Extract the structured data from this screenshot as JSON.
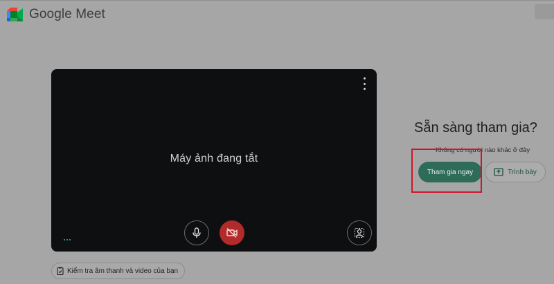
{
  "app": {
    "title": "Google Meet"
  },
  "preview": {
    "camera_off_text": "Máy ảnh đang tắt"
  },
  "icons": {
    "logo": "google-meet-logo",
    "more": "more-vert-icon",
    "mic": "mic-icon",
    "camera_off": "videocam-off-icon",
    "effects": "visual-effects-icon",
    "check": "clipboard-check-icon",
    "present": "present-screen-icon"
  },
  "check_av": {
    "label": "Kiểm tra âm thanh và video của bạn"
  },
  "join_panel": {
    "title": "Sẵn sàng tham gia?",
    "subtitle": "Không có người nào khác ở đây",
    "join_label": "Tham gia ngay",
    "present_label": "Trình bày"
  },
  "colors": {
    "join_button": "#2f6b59",
    "camera_off_button": "#b22a2a",
    "highlight": "#d0142c"
  }
}
